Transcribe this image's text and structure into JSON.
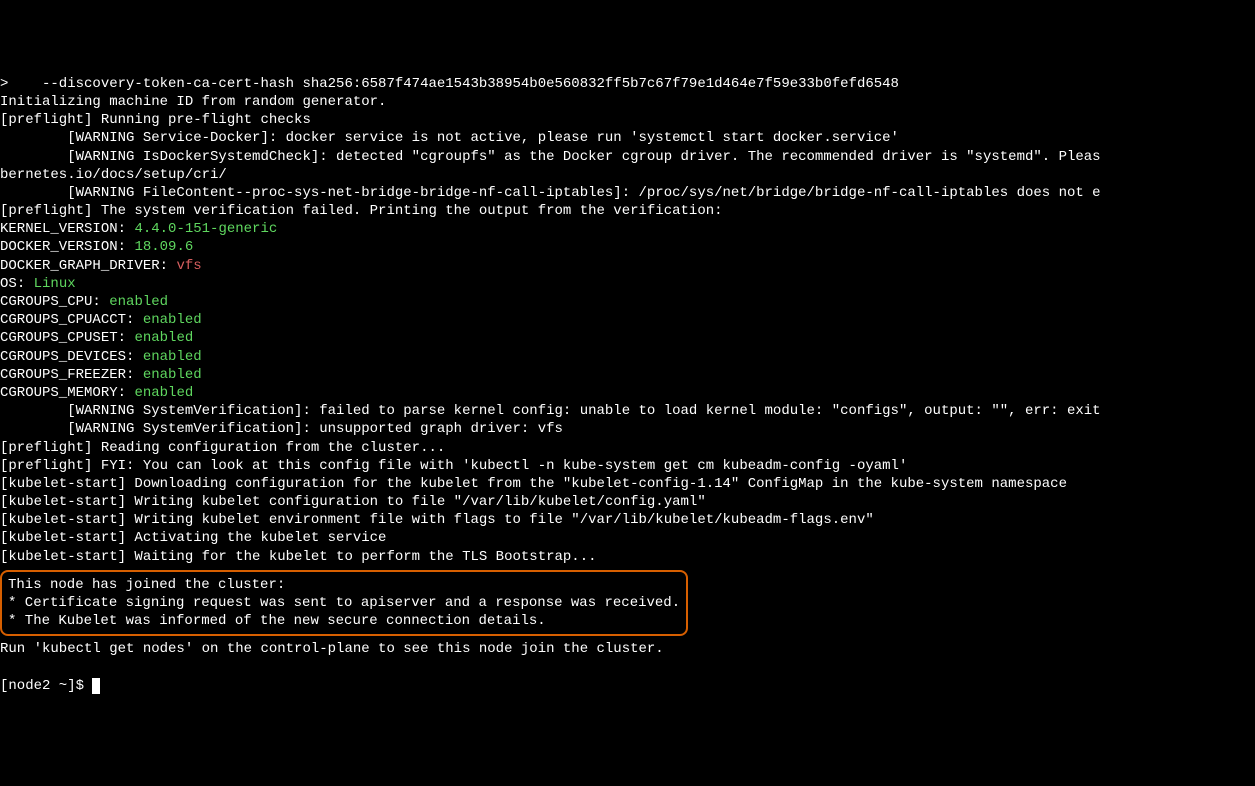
{
  "lines": {
    "l0": ">    --discovery-token-ca-cert-hash sha256:6587f474ae1543b38954b0e560832ff5b7c67f79e1d464e7f59e33b0fefd6548",
    "l1": "Initializing machine ID from random generator.",
    "l2": "[preflight] Running pre-flight checks",
    "l3": "        [WARNING Service-Docker]: docker service is not active, please run 'systemctl start docker.service'",
    "l4": "        [WARNING IsDockerSystemdCheck]: detected \"cgroupfs\" as the Docker cgroup driver. The recommended driver is \"systemd\". Pleas",
    "l5": "bernetes.io/docs/setup/cri/",
    "l6": "        [WARNING FileContent--proc-sys-net-bridge-bridge-nf-call-iptables]: /proc/sys/net/bridge/bridge-nf-call-iptables does not e",
    "l7": "[preflight] The system verification failed. Printing the output from the verification:",
    "kv": {
      "kernel_version_label": "KERNEL_VERSION",
      "kernel_version_value": "4.4.0-151-generic",
      "docker_version_label": "DOCKER_VERSION",
      "docker_version_value": "18.09.6",
      "docker_graph_driver_label": "DOCKER_GRAPH_DRIVER",
      "docker_graph_driver_value": "vfs",
      "os_label": "OS",
      "os_value": "Linux",
      "cgroups_cpu_label": "CGROUPS_CPU",
      "cgroups_cpu_value": "enabled",
      "cgroups_cpuacct_label": "CGROUPS_CPUACCT",
      "cgroups_cpuacct_value": "enabled",
      "cgroups_cpuset_label": "CGROUPS_CPUSET",
      "cgroups_cpuset_value": "enabled",
      "cgroups_devices_label": "CGROUPS_DEVICES",
      "cgroups_devices_value": "enabled",
      "cgroups_freezer_label": "CGROUPS_FREEZER",
      "cgroups_freezer_value": "enabled",
      "cgroups_memory_label": "CGROUPS_MEMORY",
      "cgroups_memory_value": "enabled"
    },
    "l18": "        [WARNING SystemVerification]: failed to parse kernel config: unable to load kernel module: \"configs\", output: \"\", err: exit",
    "l19": "        [WARNING SystemVerification]: unsupported graph driver: vfs",
    "l20": "[preflight] Reading configuration from the cluster...",
    "l21": "[preflight] FYI: You can look at this config file with 'kubectl -n kube-system get cm kubeadm-config -oyaml'",
    "l22": "[kubelet-start] Downloading configuration for the kubelet from the \"kubelet-config-1.14\" ConfigMap in the kube-system namespace",
    "l23": "[kubelet-start] Writing kubelet configuration to file \"/var/lib/kubelet/config.yaml\"",
    "l24": "[kubelet-start] Writing kubelet environment file with flags to file \"/var/lib/kubelet/kubeadm-flags.env\"",
    "l25": "[kubelet-start] Activating the kubelet service",
    "l26": "[kubelet-start] Waiting for the kubelet to perform the TLS Bootstrap...",
    "box1": "This node has joined the cluster:",
    "box2": "* Certificate signing request was sent to apiserver and a response was received.",
    "box3": "* The Kubelet was informed of the new secure connection details.",
    "l27": "Run 'kubectl get nodes' on the control-plane to see this node join the cluster.",
    "prompt": "[node2 ~]$ "
  },
  "colors": {
    "green": "#5fd75f",
    "red": "#d75f5f",
    "highlight_border": "#d75f00",
    "bg": "#000000",
    "fg": "#ffffff"
  }
}
